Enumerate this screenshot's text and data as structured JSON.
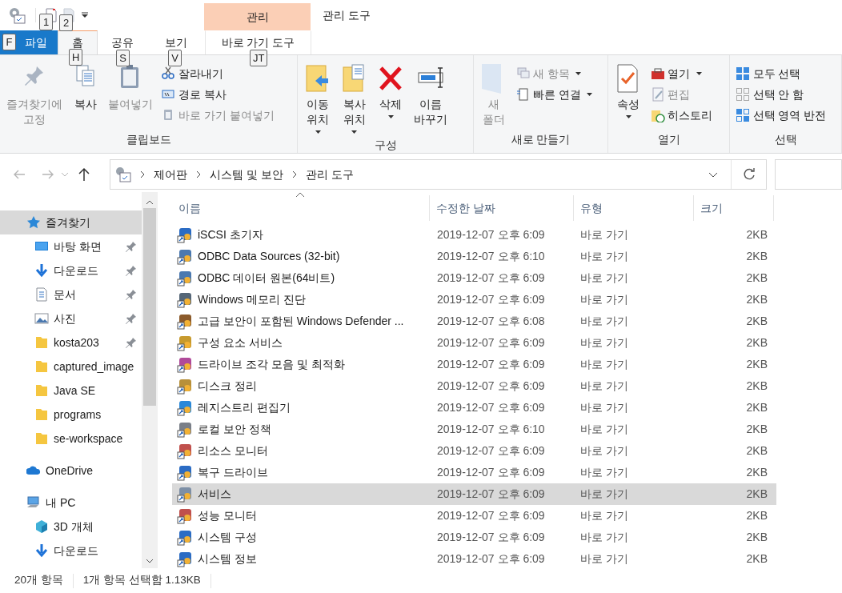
{
  "quick_access": {
    "keytips": [
      "1",
      "2"
    ]
  },
  "context_group": {
    "label": "관리"
  },
  "window_title": "관리 도구",
  "tabs": [
    {
      "label": "파일",
      "keytip": "F",
      "kind": "file",
      "selected": false
    },
    {
      "label": "홈",
      "keytip": "H",
      "kind": "tab",
      "selected": true
    },
    {
      "label": "공유",
      "keytip": "S",
      "kind": "tab",
      "selected": false
    },
    {
      "label": "보기",
      "keytip": "V",
      "kind": "tab",
      "selected": false
    },
    {
      "label": "바로 가기 도구",
      "keytip": "JT",
      "kind": "context",
      "selected": false
    }
  ],
  "ribbon_groups": [
    {
      "title": "클립보드",
      "commands": [
        {
          "kind": "large",
          "label": "즐겨찾기에\n고정",
          "dropdown": false,
          "disabled": true
        },
        {
          "kind": "large",
          "label": "복사",
          "dropdown": false,
          "disabled": false
        },
        {
          "kind": "large",
          "label": "붙여넣기",
          "dropdown": false,
          "disabled": true
        },
        {
          "kind": "small",
          "label": "잘라내기",
          "dropdown": false,
          "disabled": false
        },
        {
          "kind": "small",
          "label": "경로 복사",
          "dropdown": false,
          "disabled": false
        },
        {
          "kind": "small",
          "label": "바로 가기 붙여넣기",
          "dropdown": false,
          "disabled": true
        }
      ]
    },
    {
      "title": "구성",
      "commands": [
        {
          "kind": "large",
          "label": "이동\n위치",
          "dropdown": true,
          "disabled": false
        },
        {
          "kind": "large",
          "label": "복사\n위치",
          "dropdown": true,
          "disabled": false
        },
        {
          "kind": "large",
          "label": "삭제",
          "dropdown": true,
          "disabled": false
        },
        {
          "kind": "large",
          "label": "이름\n바꾸기",
          "dropdown": false,
          "disabled": false
        }
      ]
    },
    {
      "title": "새로 만들기",
      "commands": [
        {
          "kind": "large",
          "label": "새\n폴더",
          "dropdown": false,
          "disabled": true
        },
        {
          "kind": "small",
          "label": "새 항목",
          "dropdown": true,
          "disabled": true
        },
        {
          "kind": "small",
          "label": "빠른 연결",
          "dropdown": true,
          "disabled": false
        }
      ]
    },
    {
      "title": "열기",
      "commands": [
        {
          "kind": "large",
          "label": "속성",
          "dropdown": true,
          "disabled": false
        },
        {
          "kind": "small",
          "label": "열기",
          "dropdown": true,
          "disabled": false
        },
        {
          "kind": "small",
          "label": "편집",
          "dropdown": false,
          "disabled": true
        },
        {
          "kind": "small",
          "label": "히스토리",
          "dropdown": false,
          "disabled": false
        }
      ]
    },
    {
      "title": "선택",
      "commands": [
        {
          "kind": "small",
          "label": "모두 선택",
          "dropdown": false,
          "disabled": false
        },
        {
          "kind": "small",
          "label": "선택 안 함",
          "dropdown": false,
          "disabled": false
        },
        {
          "kind": "small",
          "label": "선택 영역 반전",
          "dropdown": false,
          "disabled": false
        }
      ]
    }
  ],
  "breadcrumbs": [
    "제어판",
    "시스템 및 보안",
    "관리 도구"
  ],
  "nav_tree": [
    {
      "label": "즐겨찾기",
      "selected": true,
      "pinned": false,
      "children": [
        {
          "label": "바탕 화면",
          "selected": false,
          "pinned": true
        },
        {
          "label": "다운로드",
          "selected": false,
          "pinned": true
        },
        {
          "label": "문서",
          "selected": false,
          "pinned": true
        },
        {
          "label": "사진",
          "selected": false,
          "pinned": true
        },
        {
          "label": "kosta203",
          "selected": false,
          "pinned": true
        },
        {
          "label": "captured_image",
          "selected": false,
          "pinned": false
        },
        {
          "label": "Java SE",
          "selected": false,
          "pinned": false
        },
        {
          "label": "programs",
          "selected": false,
          "pinned": false
        },
        {
          "label": "se-workspace",
          "selected": false,
          "pinned": false
        }
      ]
    },
    {
      "label": "OneDrive",
      "selected": false,
      "pinned": false
    },
    {
      "label": "내 PC",
      "selected": false,
      "pinned": false,
      "children": [
        {
          "label": "3D 개체",
          "selected": false,
          "pinned": false
        },
        {
          "label": "다운로드",
          "selected": false,
          "pinned": false
        }
      ]
    }
  ],
  "table": {
    "columns": [
      "이름",
      "수정한 날짜",
      "유형",
      "크기"
    ],
    "rows": [
      {
        "name": "iSCSI 초기자",
        "date": "2019-12-07 오후 6:09",
        "type": "바로 가기",
        "size": "2KB",
        "selected": false
      },
      {
        "name": "ODBC Data Sources (32-bit)",
        "date": "2019-12-07 오후 6:10",
        "type": "바로 가기",
        "size": "2KB",
        "selected": false
      },
      {
        "name": "ODBC 데이터 원본(64비트)",
        "date": "2019-12-07 오후 6:09",
        "type": "바로 가기",
        "size": "2KB",
        "selected": false
      },
      {
        "name": "Windows 메모리 진단",
        "date": "2019-12-07 오후 6:09",
        "type": "바로 가기",
        "size": "2KB",
        "selected": false
      },
      {
        "name": "고급 보안이 포함된 Windows Defender ...",
        "date": "2019-12-07 오후 6:08",
        "type": "바로 가기",
        "size": "2KB",
        "selected": false
      },
      {
        "name": "구성 요소 서비스",
        "date": "2019-12-07 오후 6:09",
        "type": "바로 가기",
        "size": "2KB",
        "selected": false
      },
      {
        "name": "드라이브 조각 모음 및 최적화",
        "date": "2019-12-07 오후 6:09",
        "type": "바로 가기",
        "size": "2KB",
        "selected": false
      },
      {
        "name": "디스크 정리",
        "date": "2019-12-07 오후 6:09",
        "type": "바로 가기",
        "size": "2KB",
        "selected": false
      },
      {
        "name": "레지스트리 편집기",
        "date": "2019-12-07 오후 6:09",
        "type": "바로 가기",
        "size": "2KB",
        "selected": false
      },
      {
        "name": "로컬 보안 정책",
        "date": "2019-12-07 오후 6:10",
        "type": "바로 가기",
        "size": "2KB",
        "selected": false
      },
      {
        "name": "리소스 모니터",
        "date": "2019-12-07 오후 6:09",
        "type": "바로 가기",
        "size": "2KB",
        "selected": false
      },
      {
        "name": "복구 드라이브",
        "date": "2019-12-07 오후 6:09",
        "type": "바로 가기",
        "size": "2KB",
        "selected": false
      },
      {
        "name": "서비스",
        "date": "2019-12-07 오후 6:09",
        "type": "바로 가기",
        "size": "2KB",
        "selected": true
      },
      {
        "name": "성능 모니터",
        "date": "2019-12-07 오후 6:09",
        "type": "바로 가기",
        "size": "2KB",
        "selected": false
      },
      {
        "name": "시스템 구성",
        "date": "2019-12-07 오후 6:09",
        "type": "바로 가기",
        "size": "2KB",
        "selected": false
      },
      {
        "name": "시스템 정보",
        "date": "2019-12-07 오후 6:09",
        "type": "바로 가기",
        "size": "2KB",
        "selected": false
      }
    ]
  },
  "status_bar": {
    "item_count": "20개 항목",
    "selection": "1개 항목 선택함 1.13KB"
  }
}
